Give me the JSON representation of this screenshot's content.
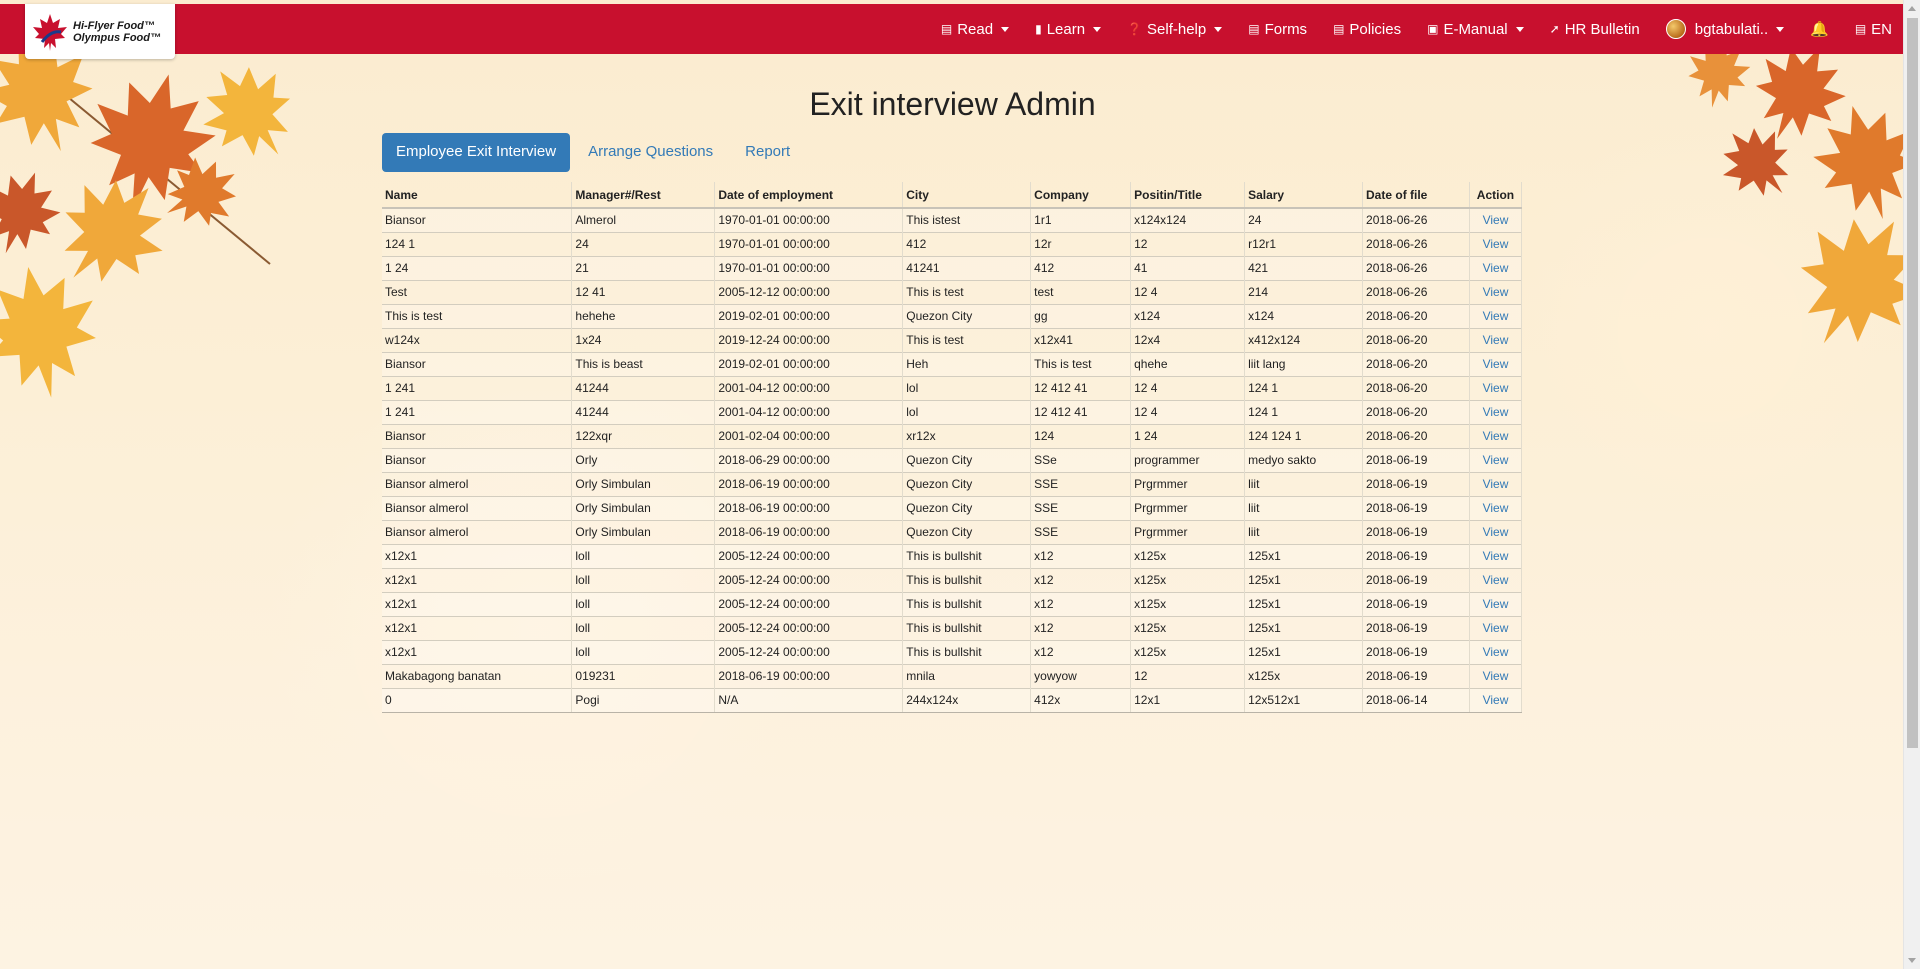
{
  "logo": {
    "line1": "Hi-Flyer Food™",
    "line2": "Olympus Food™"
  },
  "nav": {
    "items": [
      {
        "label": "Read",
        "icon": "newspaper-icon",
        "dropdown": true
      },
      {
        "label": "Learn",
        "icon": "book-icon",
        "dropdown": true
      },
      {
        "label": "Self-help",
        "icon": "help-circle-icon",
        "dropdown": true
      },
      {
        "label": "Forms",
        "icon": "form-icon",
        "dropdown": false
      },
      {
        "label": "Policies",
        "icon": "policies-icon",
        "dropdown": false
      },
      {
        "label": "E-Manual",
        "icon": "manual-icon",
        "dropdown": true
      },
      {
        "label": "HR Bulletin",
        "icon": "pin-icon",
        "dropdown": false
      }
    ],
    "user": "bgtabulati..",
    "language": "EN"
  },
  "page": {
    "title": "Exit interview Admin"
  },
  "tabs": [
    {
      "label": "Employee Exit Interview",
      "active": true
    },
    {
      "label": "Arrange Questions",
      "active": false
    },
    {
      "label": "Report",
      "active": false
    }
  ],
  "table": {
    "headers": [
      "Name",
      "Manager#/Rest",
      "Date of employment",
      "City",
      "Company",
      "Positin/Title",
      "Salary",
      "Date of file",
      "Action"
    ],
    "rows": [
      [
        "Biansor",
        "Almerol",
        "1970-01-01 00:00:00",
        "This istest",
        "1r1",
        "x124x124",
        "24",
        "2018-06-26",
        "View"
      ],
      [
        "124 1",
        "24",
        "1970-01-01 00:00:00",
        "412",
        "12r",
        "12",
        "r12r1",
        "2018-06-26",
        "View"
      ],
      [
        "1 24",
        "21",
        "1970-01-01 00:00:00",
        "41241",
        "412",
        "41",
        "421",
        "2018-06-26",
        "View"
      ],
      [
        "Test",
        "12 41",
        "2005-12-12 00:00:00",
        "This is test",
        "test",
        "12 4",
        "214",
        "2018-06-26",
        "View"
      ],
      [
        "This is test",
        "hehehe",
        "2019-02-01 00:00:00",
        "Quezon City",
        "gg",
        "x124",
        "x124",
        "2018-06-20",
        "View"
      ],
      [
        "w124x",
        "1x24",
        "2019-12-24 00:00:00",
        "This is test",
        "x12x41",
        "12x4",
        "x412x124",
        "2018-06-20",
        "View"
      ],
      [
        "Biansor",
        "This is beast",
        "2019-02-01 00:00:00",
        "Heh",
        "This is test",
        "qhehe",
        "liit lang",
        "2018-06-20",
        "View"
      ],
      [
        "1 241",
        "41244",
        "2001-04-12 00:00:00",
        "lol",
        "12 412 41",
        "12 4",
        "124 1",
        "2018-06-20",
        "View"
      ],
      [
        "1 241",
        "41244",
        "2001-04-12 00:00:00",
        "lol",
        "12 412 41",
        "12 4",
        "124 1",
        "2018-06-20",
        "View"
      ],
      [
        "Biansor",
        "122xqr",
        "2001-02-04 00:00:00",
        "xr12x",
        "124",
        "1 24",
        "124 124 1",
        "2018-06-20",
        "View"
      ],
      [
        "Biansor",
        "Orly",
        "2018-06-29 00:00:00",
        "Quezon City",
        "SSe",
        "programmer",
        "medyo sakto",
        "2018-06-19",
        "View"
      ],
      [
        "Biansor almerol",
        "Orly Simbulan",
        "2018-06-19 00:00:00",
        "Quezon City",
        "SSE",
        "Prgrmmer",
        "liit",
        "2018-06-19",
        "View"
      ],
      [
        "Biansor almerol",
        "Orly Simbulan",
        "2018-06-19 00:00:00",
        "Quezon City",
        "SSE",
        "Prgrmmer",
        "liit",
        "2018-06-19",
        "View"
      ],
      [
        "Biansor almerol",
        "Orly Simbulan",
        "2018-06-19 00:00:00",
        "Quezon City",
        "SSE",
        "Prgrmmer",
        "liit",
        "2018-06-19",
        "View"
      ],
      [
        "x12x1",
        "loll",
        "2005-12-24 00:00:00",
        "This is bullshit",
        "x12",
        "x125x",
        "125x1",
        "2018-06-19",
        "View"
      ],
      [
        "x12x1",
        "loll",
        "2005-12-24 00:00:00",
        "This is bullshit",
        "x12",
        "x125x",
        "125x1",
        "2018-06-19",
        "View"
      ],
      [
        "x12x1",
        "loll",
        "2005-12-24 00:00:00",
        "This is bullshit",
        "x12",
        "x125x",
        "125x1",
        "2018-06-19",
        "View"
      ],
      [
        "x12x1",
        "loll",
        "2005-12-24 00:00:00",
        "This is bullshit",
        "x12",
        "x125x",
        "125x1",
        "2018-06-19",
        "View"
      ],
      [
        "x12x1",
        "loll",
        "2005-12-24 00:00:00",
        "This is bullshit",
        "x12",
        "x125x",
        "125x1",
        "2018-06-19",
        "View"
      ],
      [
        "Makabagong banatan",
        "019231",
        "2018-06-19 00:00:00",
        "mnila",
        "yowyow",
        "12",
        "x125x",
        "2018-06-19",
        "View"
      ],
      [
        "0",
        "Pogi",
        "N/A",
        "244x124x",
        "412x",
        "12x1",
        "12x512x1",
        "2018-06-14",
        "View"
      ]
    ]
  },
  "colors": {
    "navbar": "#c8102e",
    "accent": "#337ab7",
    "background": "#fcefd6"
  }
}
